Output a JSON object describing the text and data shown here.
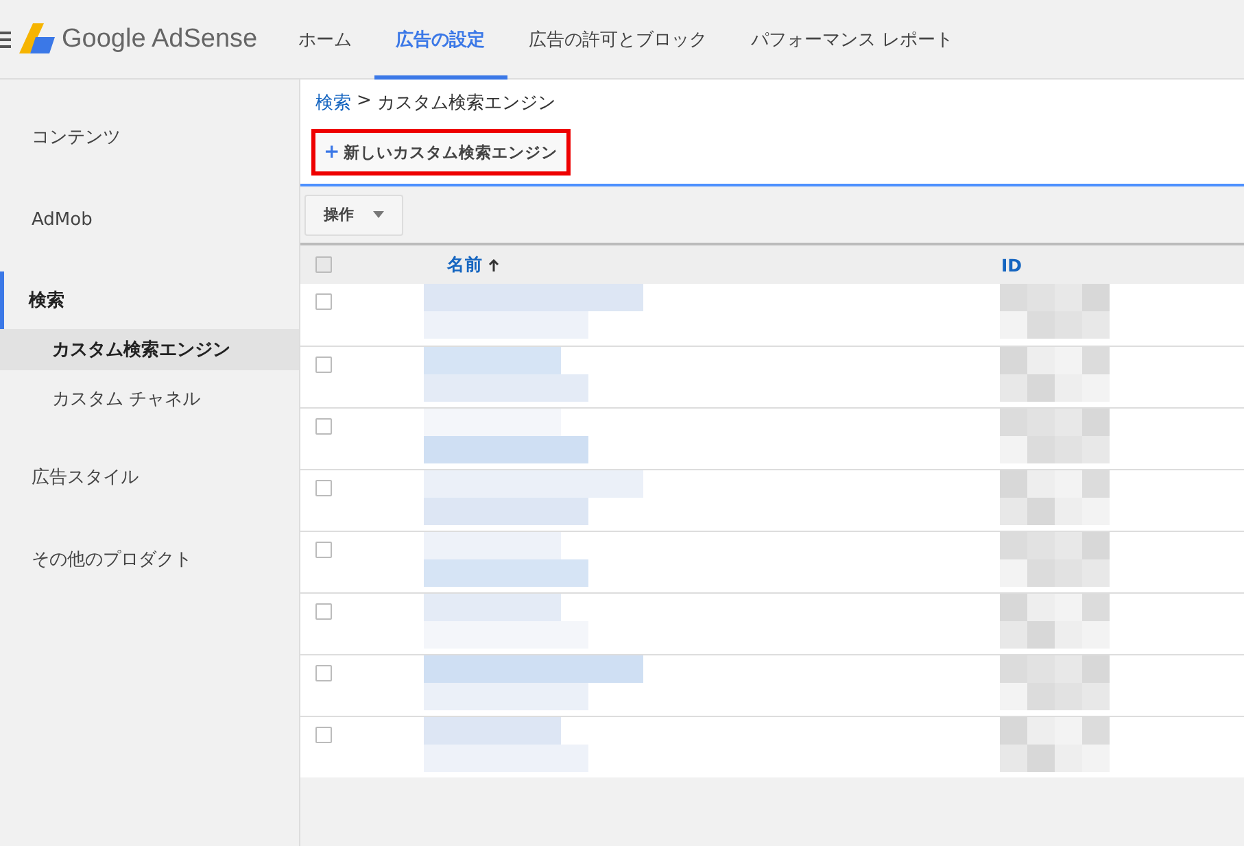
{
  "header": {
    "brand": "Google AdSense",
    "nav": [
      {
        "label": "ホーム",
        "selected": false
      },
      {
        "label": "広告の設定",
        "selected": true
      },
      {
        "label": "広告の許可とブロック",
        "selected": false
      },
      {
        "label": "パフォーマンス レポート",
        "selected": false
      }
    ]
  },
  "sidebar": {
    "items": [
      {
        "label": "コンテンツ",
        "kind": "section",
        "selected": false
      },
      {
        "label": "AdMob",
        "kind": "section",
        "selected": false
      },
      {
        "label": "検索",
        "kind": "section",
        "selected": true
      },
      {
        "label": "カスタム検索エンジン",
        "kind": "sub",
        "selected": true
      },
      {
        "label": "カスタム チャネル",
        "kind": "sub",
        "selected": false
      },
      {
        "label": "広告スタイル",
        "kind": "section",
        "selected": false
      },
      {
        "label": "その他のプロダクト",
        "kind": "section",
        "selected": false
      }
    ]
  },
  "breadcrumb": {
    "link": "検索",
    "separator": ">",
    "current": "カスタム検索エンジン"
  },
  "new_button": {
    "icon": "+",
    "label": "新しいカスタム検索エンジン",
    "highlighted": true
  },
  "toolbar": {
    "actions": "操作"
  },
  "table": {
    "columns": [
      {
        "label": "名前",
        "sorted": true
      },
      {
        "label": "ID",
        "sorted": false
      }
    ],
    "header_checked": false,
    "rows": [
      {
        "checked": false
      },
      {
        "checked": false
      },
      {
        "checked": false
      },
      {
        "checked": false
      },
      {
        "checked": false
      },
      {
        "checked": false
      },
      {
        "checked": false
      },
      {
        "checked": false
      }
    ]
  }
}
